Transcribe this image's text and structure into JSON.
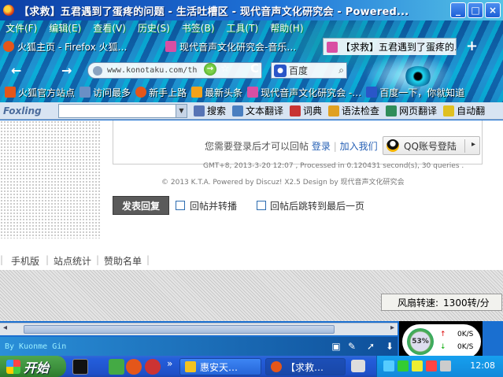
{
  "window": {
    "title": "【求救】五君遇到了蛋疼的问题 - 生活吐槽区 - 现代音声文化研究会 - Powered...",
    "min_label": "_",
    "max_label": "□",
    "close_label": "×"
  },
  "menu": [
    "文件(F)",
    "编辑(E)",
    "查看(V)",
    "历史(S)",
    "书签(B)",
    "工具(T)",
    "帮助(H)"
  ],
  "tabs": [
    {
      "label": "火狐主页 - Firefox 火狐…",
      "icon": "firefox-icon",
      "color": "#e4561a"
    },
    {
      "label": "现代音声文化研究会-音乐…",
      "icon": "page-icon",
      "color": "#d94fa3"
    },
    {
      "label": "【求救】五君遇到了蛋疼的…",
      "icon": "page-icon",
      "color": "#d94fa3"
    }
  ],
  "tab_add": "+",
  "nav": {
    "back": "←",
    "forward": "→",
    "url": "www.konotaku.com/th",
    "go": "→",
    "star": "☆",
    "reload": "C",
    "search_engine": "百度",
    "search_icon": "magnifier-icon"
  },
  "bookmarks": [
    {
      "label": "火狐官方站点",
      "color": "#e4561a"
    },
    {
      "label": "访问最多",
      "color": "#6a8fc5"
    },
    {
      "label": "新手上路",
      "color": "#e4561a"
    },
    {
      "label": "最新头条",
      "color": "#f3a21a"
    },
    {
      "label": "现代音声文化研究会 -…",
      "color": "#d94fa3"
    },
    {
      "label": "百度一下，你就知道",
      "color": "#2a56c8"
    }
  ],
  "foxling": {
    "logo": "Foxling",
    "buttons": [
      {
        "label": "搜索",
        "color": "#5774b5"
      },
      {
        "label": "文本翻译",
        "color": "#4a7fc0"
      },
      {
        "label": "词典",
        "color": "#c83333"
      },
      {
        "label": "语法检查",
        "color": "#e0a020"
      },
      {
        "label": "网页翻译",
        "color": "#2f8d5a"
      },
      {
        "label": "自动翻",
        "color": "#e0c020"
      }
    ]
  },
  "reply": {
    "login_prompt": "您需要登录后才可以回帖",
    "login_link": "登录",
    "separator": "|",
    "register_link": "加入我们",
    "qq_login": "QQ账号登陆",
    "qq_arrow": "▸",
    "submit": "发表回复",
    "opt1": "回帖并转播",
    "opt2": "回帖后跳转到最后一页"
  },
  "footer": {
    "links": [
      "手机版",
      "站点统计",
      "赞助名单"
    ],
    "line1": "GMT+8, 2013-3-20 12:07 , Processed in 0.120431 second(s), 30 queries .",
    "line2": "© 2013 K.T.A. Powered by Discuz! X2.5  Design by 现代音声文化研究会"
  },
  "fan": {
    "label": "风扇转速:",
    "value": "1300转/分"
  },
  "statusbar": {
    "text": "By Kuonme Gin"
  },
  "netmon": {
    "percent": "53%",
    "up_arrow": "↑",
    "down_arrow": "↓",
    "up": "0K/S",
    "down": "0K/S"
  },
  "taskbar": {
    "start": "开始",
    "windows": [
      {
        "label": "惠安天…",
        "color": "#f3c320",
        "active": false
      },
      {
        "label": "【求救…",
        "color": "#e4561a",
        "active": true
      }
    ],
    "clock": "12:08"
  }
}
